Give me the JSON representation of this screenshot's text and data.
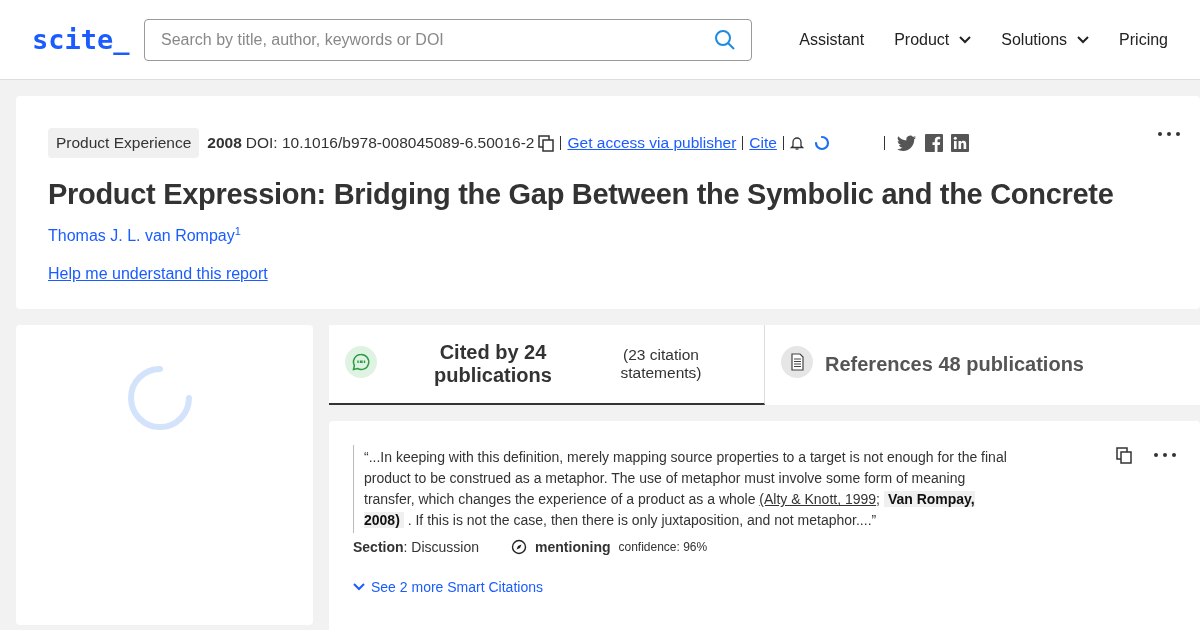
{
  "header": {
    "logo": "scite_",
    "search": {
      "placeholder": "Search by title, author, keywords or DOI"
    },
    "nav": [
      {
        "label": "Assistant",
        "dropdown": false
      },
      {
        "label": "Product",
        "dropdown": true
      },
      {
        "label": "Solutions",
        "dropdown": true
      },
      {
        "label": "Pricing",
        "dropdown": false
      }
    ]
  },
  "paper": {
    "tag": "Product Experience",
    "year": "2008",
    "doi": "DOI: 10.1016/b978-008045089-6.50016-2",
    "links": [
      "Get access via publisher",
      "Cite"
    ],
    "title": "Product Expression: Bridging the Gap Between the Symbolic and the Concrete",
    "author": "Thomas J. L. van Rompay",
    "author_mark": "1",
    "help_link": "Help me understand this report"
  },
  "tabs": [
    {
      "kind": "cited",
      "title": "Cited by 24 publications",
      "subtitle": "(23 citation statements)",
      "selected": true
    },
    {
      "kind": "references",
      "title": "References 48 publications",
      "selected": false
    }
  ],
  "citation": {
    "quote": [
      {
        "kind": "text",
        "text": "“...In keeping with this definition, merely mapping source properties to a target is not enough for the final product to be construed as a metaphor. The use of metaphor must involve some form of meaning transfer, which changes the experience of a product as a whole "
      },
      {
        "kind": "link",
        "text": "(Alty & Knott, 1999"
      },
      {
        "kind": "text",
        "text": "; "
      },
      {
        "kind": "self",
        "text": "Van Rompay, 2008)"
      },
      {
        "kind": "text",
        "text": " . If this is not the case, then there is only juxtaposition, and not metaphor....”"
      }
    ],
    "section_label": "Section",
    "section_value": ": Discussion",
    "classification": "mentioning",
    "confidence": "confidence: 96%",
    "more_link": "See 2 more Smart Citations"
  }
}
